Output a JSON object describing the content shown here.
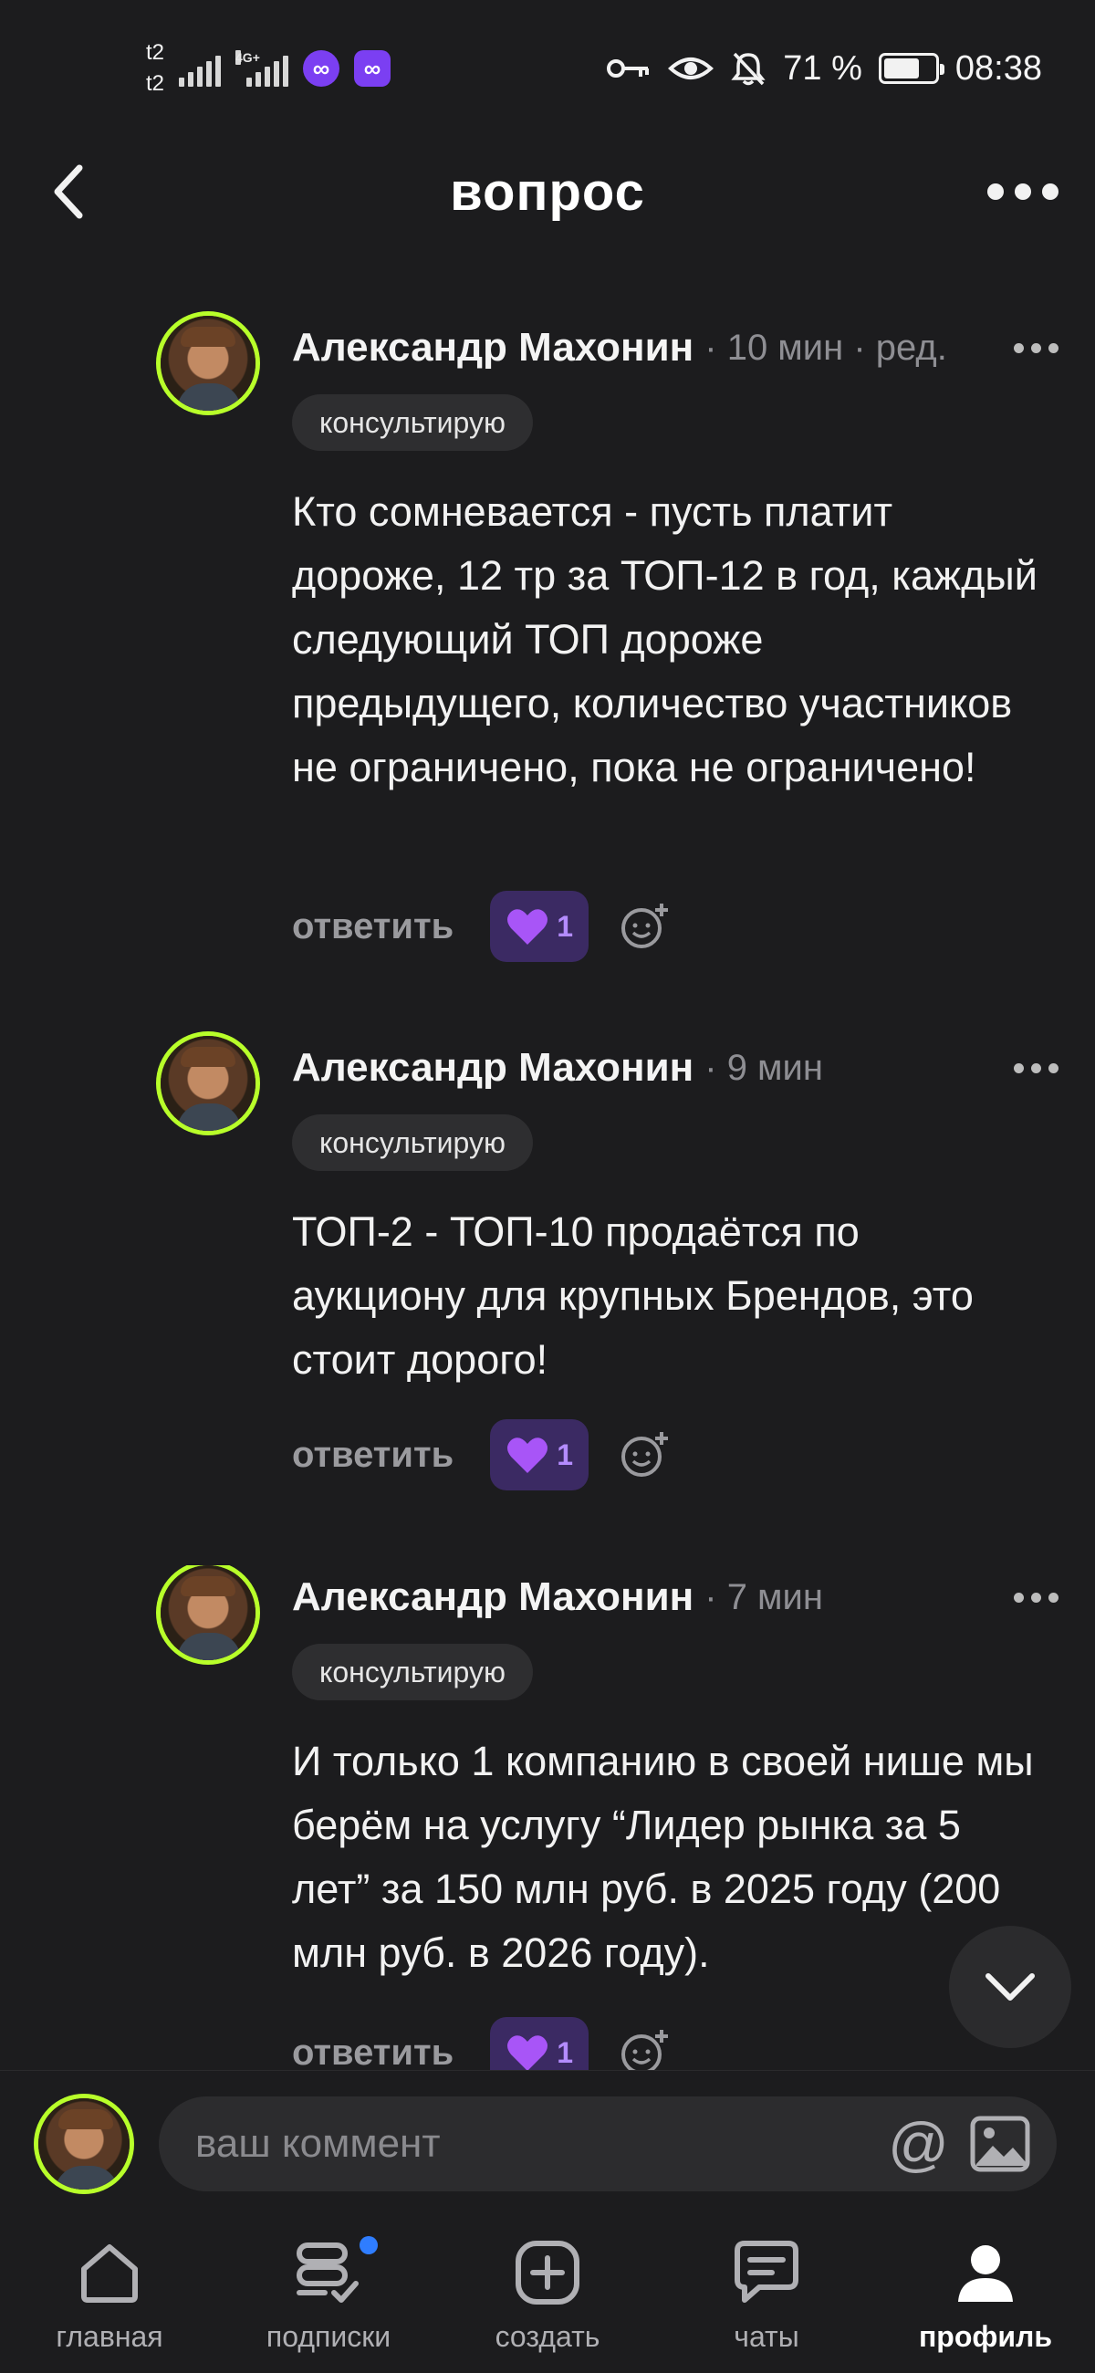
{
  "status_bar": {
    "carrier1": "t2",
    "carrier2": "t2",
    "network": "4G+",
    "battery_percent": "71 %",
    "battery_level": 0.71,
    "time": "08:38"
  },
  "header": {
    "title": "вопрос"
  },
  "comments": [
    {
      "author": "Александр Махонин",
      "meta": "· 10 мин · ред.",
      "badge": "консультирую",
      "text": "Кто сомневается - пусть платит дороже, 12 тр за ТОП-12 в год, каждый следующий ТОП дороже предыдущего, количество участников не ограничено, пока не ограничено!",
      "reply": "ответить",
      "likes": "1"
    },
    {
      "author": "Александр Махонин",
      "meta": "· 9 мин",
      "badge": "консультирую",
      "text": "ТОП-2 - ТОП-10 продаётся по аукциону для крупных Брендов, это стоит дорого!",
      "reply": "ответить",
      "likes": "1"
    },
    {
      "author": "Александр Махонин",
      "meta": "· 7 мин",
      "badge": "консультирую",
      "text": "И только 1 компанию в своей нише мы берём на услугу “Лидер рынка за 5 лет” за 150 млн руб. в 2025 году (200 млн руб. в 2026 году).",
      "reply": "ответить",
      "likes": "1"
    }
  ],
  "comment_input": {
    "placeholder": "ваш коммент"
  },
  "bottom_nav": [
    {
      "label": "главная",
      "icon": "home-icon"
    },
    {
      "label": "подписки",
      "icon": "subscriptions-icon"
    },
    {
      "label": "создать",
      "icon": "create-icon"
    },
    {
      "label": "чаты",
      "icon": "chat-icon"
    },
    {
      "label": "профиль",
      "icon": "profile-icon"
    }
  ],
  "colors": {
    "background": "#1c1c1e",
    "accent": "#7b3ff2",
    "like_bg": "#3b2a63",
    "avatar_ring": "#b8ff2a"
  }
}
